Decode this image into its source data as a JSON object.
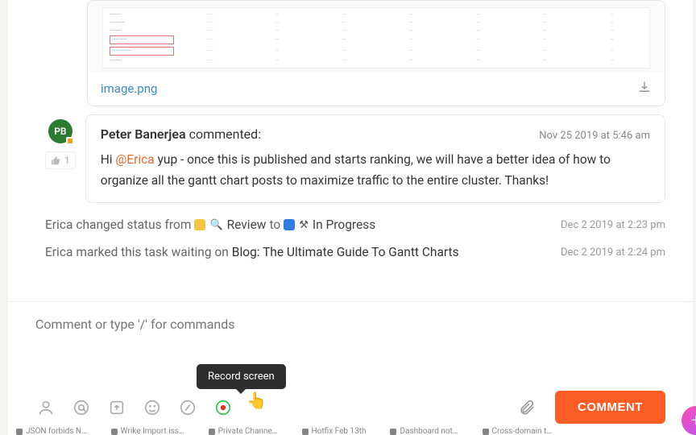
{
  "attachment": {
    "filename": "image.png"
  },
  "comment": {
    "avatar_initials": "PB",
    "author": "Peter Banerjea",
    "action": "commented:",
    "timestamp": "Nov 25 2019 at 5:46 am",
    "like_count": "1",
    "text_prefix": "Hi ",
    "mention": "@Erica",
    "text_rest": " yup - once this is published and starts ranking, we will have a better idea of how to organize all the gantt chart posts to maximize traffic to the entire cluster. Thanks!"
  },
  "activity": {
    "status_change": {
      "actor": "Erica",
      "verb": "changed status from",
      "from_label": "Review",
      "to_word": "to",
      "to_label": "In Progress",
      "timestamp": "Dec 2 2019 at 2:23 pm"
    },
    "waiting": {
      "actor": "Erica",
      "verb": "marked this task waiting on",
      "task": "Blog: The Ultimate Guide To Gantt Charts",
      "timestamp": "Dec 2 2019 at 2:24 pm"
    }
  },
  "composer": {
    "placeholder": "Comment or type '/' for commands",
    "tooltip": "Record screen",
    "submit_label": "COMMENT"
  },
  "taskbar": {
    "items": [
      "JSON forbids N…",
      "Wrike Import iss…",
      "Private Channe…",
      "Hotfix Feb 13th",
      "Dashboard not…",
      "Cross-domain t…"
    ]
  }
}
